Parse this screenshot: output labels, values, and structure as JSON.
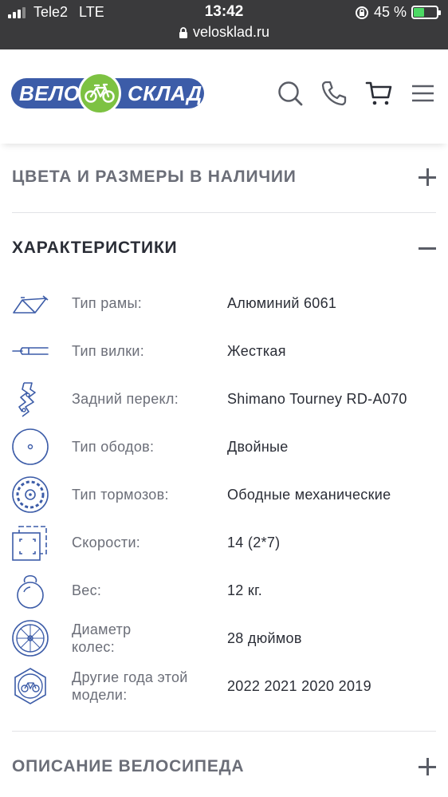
{
  "status_bar": {
    "carrier": "Tele2",
    "network": "LTE",
    "time": "13:42",
    "battery": "45 %",
    "battery_level": 0.45,
    "url": "velosklad.ru"
  },
  "header": {
    "logo_left": "ВЕЛО",
    "logo_right": "СКЛАД",
    "icons": [
      "search-icon",
      "phone-icon",
      "cart-icon",
      "menu-icon"
    ]
  },
  "sections": {
    "colors_sizes": "ЦВЕТА И РАЗМЕРЫ В НАЛИЧИИ",
    "characteristics": "ХАРАКТЕРИСТИКИ",
    "description": "ОПИСАНИЕ ВЕЛОСИПЕДА"
  },
  "specs": [
    {
      "label": "Тип рамы:",
      "value": "Алюминий 6061",
      "icon": "frame-icon"
    },
    {
      "label": "Тип вилки:",
      "value": "Жесткая",
      "icon": "fork-icon"
    },
    {
      "label": "Задний перекл:",
      "value": "Shimano Tourney RD-A070",
      "icon": "derailleur-icon"
    },
    {
      "label": "Тип ободов:",
      "value": "Двойные",
      "icon": "rim-icon"
    },
    {
      "label": "Тип тормозов:",
      "value": "Ободные механические",
      "icon": "brake-icon"
    },
    {
      "label": "Скорости:",
      "value": "14 (2*7)",
      "icon": "speeds-icon"
    },
    {
      "label": "Вес:",
      "value": "12 кг.",
      "icon": "weight-icon"
    },
    {
      "label": "Диаметр колес:",
      "value": "28 дюймов",
      "icon": "wheel-icon"
    },
    {
      "label": "Другие года этой модели:",
      "value": "2022 2021 2020 2019",
      "icon": "bike-badge-icon"
    }
  ],
  "colors": {
    "status_bg": "#3a3a3c",
    "brand_blue": "#3c5ca8",
    "brand_green": "#7dc242",
    "icon_blue": "#3c5ca8"
  }
}
